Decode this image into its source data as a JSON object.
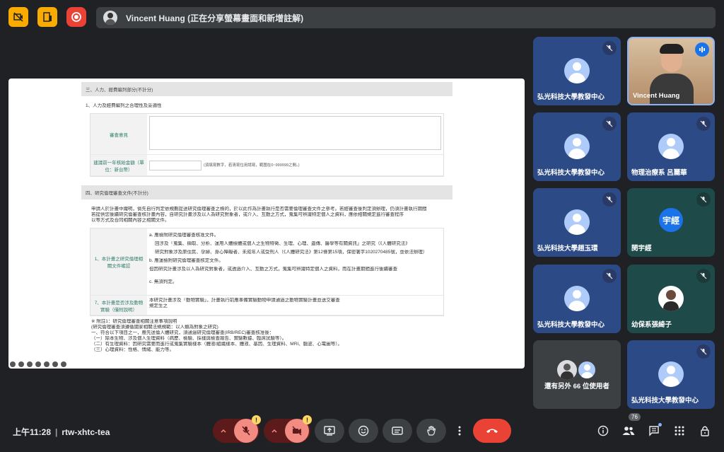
{
  "banner": {
    "text": "Vincent Huang (正在分享螢幕畫面和新增註解)"
  },
  "doc": {
    "section1": "三、人力、經費編列部分(不計分)",
    "q1": "1、人力及經費編列之合理性及妥適性",
    "review_label": "審查意見",
    "budget_label": "建議前一年核給金額（單位：新台幣）",
    "budget_hint": "(須填寫數字，若清寫位用請寫，範圍在0~999999之間。)",
    "section2": "四、研究倫理審查文件(不計分)",
    "para": [
      "申請人於計畫中織明，倘先自行判定依規劃提送研究倫理審查之標的，於以此作為計畫執行是否需要倫理審查文件之參考。若經審查後判定須辦理，仍須計畫執行期間",
      "若提供您後續研究倫審查核計畫內容，自研究計畫涉及以人為研究對象者，或介入、互動之方式，蒐集可辨識特定個人之資料，應依相關規定進行審查程序",
      "以等方式及合同相關內容之相關文件。"
    ],
    "row1_label": "1、本計畫之研究倫理相關文件確認",
    "opts": [
      "a. 應檢附研究倫理審查核准文件。",
      "回涉及「蒐集、擷取、分析、運用人體檢體或個人之生物特徵、生理、心理、遺傳、醫學等有關資訊」之研究（《人體研究法》",
      "研究對象涉及原住民、孕婦、身心障礙者、未成年人或受刑人（《人體研究法》第12條第15項，保密署字1020270485號，並依法辦理）",
      "b. 應運檢附研究倫理審查核定文件。",
      "但因研究計畫涉及以人為研究對象者，或透過介入、互動之方式，蒐集可辨識特定個人之資料，而在計畫期間進行後續審查",
      "c. 無須判定。"
    ],
    "row2_label": "7、本計畫是否涉及動物實驗（僅附說明）",
    "row2_text": "本研究計畫涉及「動物實驗」，計畫執行前應準備實驗動物申請通過之動物實驗計畫並送交審查",
    "row2_text2": "規定生之",
    "notes": [
      "※ 附註1：研究倫理審查相關注意事項說明",
      "(研究倫理審查須遵循國家相關法規規範：以人類為對象之研究)",
      "一、符合以下項目之一，應先送倫人體研究，須通過研究倫理審查(IRB/REC)審查核准後：",
      "（一）除本生物、涉及個人生理資料（病歷、檢驗、採樣與檢查報告、實驗數據、臨床試驗等）。",
      "（二）有生理資料：因研究需要而進行或蒐集實驗樣本（體液/組織樣本、體液、基因、生理資料、MRI、腦波、心電圖等）。",
      "（三）心理資料：性格、情緒、能力等。"
    ]
  },
  "participants": [
    {
      "name": "弘光科技大學教發中心",
      "type": "avatar",
      "muted": true
    },
    {
      "name": "Vincent Huang",
      "type": "video",
      "muted": false
    },
    {
      "name": "弘光科技大學教發中心",
      "type": "avatar",
      "muted": true
    },
    {
      "name": "物理治療系 呂麗華",
      "type": "avatar",
      "muted": true
    },
    {
      "name": "弘光科技大學趙玉環",
      "type": "avatar",
      "muted": true
    },
    {
      "name": "閔宇經",
      "type": "letter",
      "letter": "宇經",
      "muted": true
    },
    {
      "name": "弘光科技大學教發中心",
      "type": "avatar",
      "muted": true
    },
    {
      "name": "幼保系張綺子",
      "type": "photo",
      "muted": true
    },
    {
      "name": "還有另外 66 位使用者",
      "type": "group",
      "muted": false
    },
    {
      "name": "弘光科技大學教發中心",
      "type": "avatar",
      "muted": true
    }
  ],
  "bottom": {
    "time": "上午11:28",
    "meeting_code": "rtw-xhtc-tea",
    "people_count": "76"
  },
  "colors": {
    "end_call": "#ea4335",
    "tile_blue": "#2c4a86",
    "warning": "#fdd663"
  }
}
